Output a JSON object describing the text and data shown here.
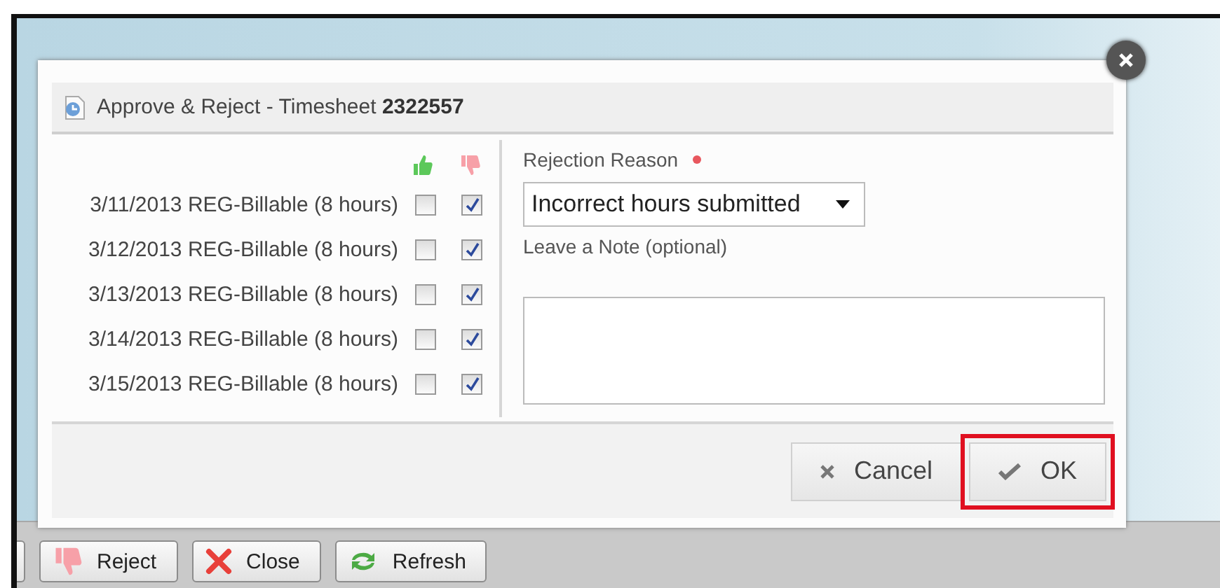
{
  "dialog": {
    "title": "Approve & Reject - Timesheet **2322557**",
    "entries": [
      {
        "label": "3/11/2013 REG-Billable (8 hours)",
        "approved": false,
        "rejected": true
      },
      {
        "label": "3/12/2013 REG-Billable (8 hours)",
        "approved": false,
        "rejected": true
      },
      {
        "label": "3/13/2013 REG-Billable (8 hours)",
        "approved": false,
        "rejected": true
      },
      {
        "label": "3/14/2013 REG-Billable (8 hours)",
        "approved": false,
        "rejected": true
      },
      {
        "label": "3/15/2013 REG-Billable (8 hours)",
        "approved": false,
        "rejected": true
      }
    ],
    "rejection_reason": {
      "label": "Rejection Reason",
      "required": true,
      "value": "Incorrect hours submitted"
    },
    "note": {
      "label": "Leave a Note (optional)"
    },
    "buttons": [
      {
        "kind": "cancel",
        "label": "Cancel",
        "highlighted": false
      },
      {
        "kind": "ok",
        "label": "OK",
        "highlighted": true
      }
    ]
  },
  "toolbar": [
    {
      "kind": "partial"
    },
    {
      "kind": "reject",
      "label": "Reject"
    },
    {
      "kind": "close",
      "label": "Close"
    },
    {
      "kind": "refresh",
      "label": "Refresh"
    }
  ]
}
